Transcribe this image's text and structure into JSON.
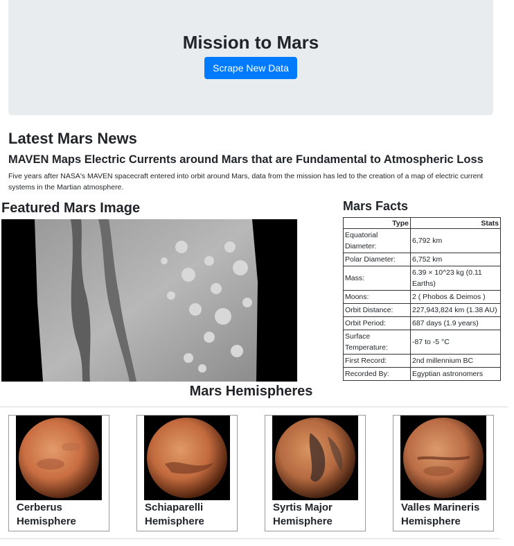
{
  "header": {
    "title": "Mission to Mars",
    "scrape_button": "Scrape New Data"
  },
  "news": {
    "section_title": "Latest Mars News",
    "headline": "MAVEN Maps Electric Currents around Mars that are Fundamental to Atmospheric Loss",
    "teaser": "Five years after NASA's MAVEN spacecraft entered into orbit around Mars, data from the mission has led to the creation of a map of electric current systems in the Martian atmosphere."
  },
  "featured": {
    "section_title": "Featured Mars Image"
  },
  "facts": {
    "section_title": "Mars Facts",
    "col_type": "Type",
    "col_stats": "Stats",
    "rows": [
      {
        "type": "Equatorial Diameter:",
        "value": "6,792 km"
      },
      {
        "type": "Polar Diameter:",
        "value": "6,752 km"
      },
      {
        "type": "Mass:",
        "value": "6.39 × 10^23 kg (0.11 Earths)"
      },
      {
        "type": "Moons:",
        "value": "2 ( Phobos & Deimos )"
      },
      {
        "type": "Orbit Distance:",
        "value": "227,943,824 km (1.38 AU)"
      },
      {
        "type": "Orbit Period:",
        "value": "687 days (1.9 years)"
      },
      {
        "type": "Surface Temperature:",
        "value": "-87 to -5 °C"
      },
      {
        "type": "First Record:",
        "value": "2nd millennium BC"
      },
      {
        "type": "Recorded By:",
        "value": "Egyptian astronomers"
      }
    ]
  },
  "hemispheres": {
    "section_title": "Mars Hemispheres",
    "items": [
      {
        "title": "Cerberus Hemisphere"
      },
      {
        "title": "Schiaparelli Hemisphere"
      },
      {
        "title": "Syrtis Major Hemisphere"
      },
      {
        "title": "Valles Marineris Hemisphere"
      }
    ]
  },
  "colors": {
    "jumbotron_bg": "#e9ecef",
    "primary_button": "#007bff",
    "text": "#212529"
  }
}
